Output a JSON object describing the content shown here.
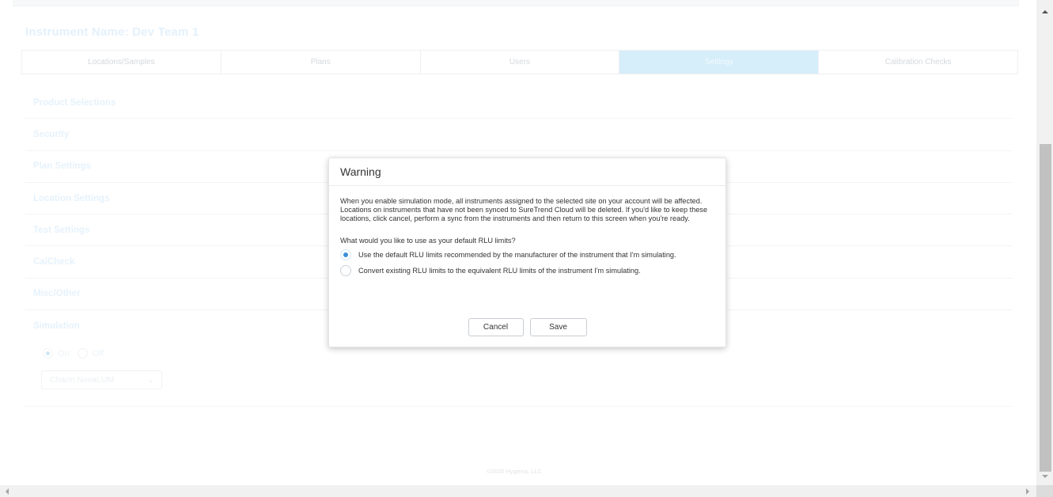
{
  "instrument_title": "Instrument Name: Dev Team 1",
  "tabs": [
    {
      "label": "Locations/Samples",
      "active": false
    },
    {
      "label": "Plans",
      "active": false
    },
    {
      "label": "Users",
      "active": false
    },
    {
      "label": "Settings",
      "active": true
    },
    {
      "label": "Calibration Checks",
      "active": false
    }
  ],
  "sections": [
    {
      "label": "Product Selections"
    },
    {
      "label": "Security"
    },
    {
      "label": "Plan Settings"
    },
    {
      "label": "Location Settings"
    },
    {
      "label": "Test Settings"
    },
    {
      "label": "CalCheck"
    },
    {
      "label": "Misc/Other"
    },
    {
      "label": "Simulation"
    }
  ],
  "simulation": {
    "on_label": "On",
    "off_label": "Off",
    "selected": "On",
    "instrument_select_value": "Charm NovaLUM"
  },
  "footer": {
    "copyright": "©2020 Hygiena, LLC"
  },
  "modal": {
    "title": "Warning",
    "message": "When you enable simulation mode, all instruments assigned to the selected site on your account will be affected. Locations on instruments that have not been synced to SureTrend Cloud will be deleted. If you'd like to keep these locations, click cancel, perform a sync from the instruments and then return to this screen when you're ready.",
    "question": "What would you like to use as your default RLU limits?",
    "options": [
      {
        "label": "Use the default RLU limits recommended by the manufacturer of the instrument that I'm simulating.",
        "selected": true
      },
      {
        "label": "Convert existing RLU limits to the equivalent RLU limits of the instrument I'm simulating.",
        "selected": false
      }
    ],
    "cancel_label": "Cancel",
    "save_label": "Save"
  },
  "colors": {
    "active_tab_bg": "#d6eefa",
    "radio_selected": "#3d8fd8"
  }
}
